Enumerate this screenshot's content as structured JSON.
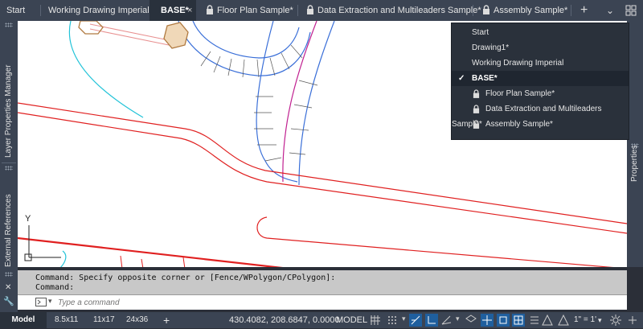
{
  "tabs": [
    {
      "label": "Start"
    },
    {
      "label": "Working Drawing Imperial"
    },
    {
      "label": "BASE*"
    },
    {
      "label": "Floor Plan Sample*"
    },
    {
      "label": "Data Extraction and Multileaders Sample*"
    },
    {
      "label": "Assembly Sample*"
    }
  ],
  "tab_close": "×",
  "new_tab": "+",
  "menu_caret": "⌄",
  "side_panels": {
    "left_top": "Layer Properties Manager",
    "left_bottom": "External References",
    "right": "Properties"
  },
  "dropdown": {
    "items": [
      {
        "label": "Start",
        "locked": false,
        "checked": false
      },
      {
        "label": "Drawing1*",
        "locked": false,
        "checked": false
      },
      {
        "label": "Working Drawing Imperial",
        "locked": false,
        "checked": false
      },
      {
        "label": "BASE*",
        "locked": false,
        "checked": true
      },
      {
        "label": "Floor Plan Sample*",
        "locked": true,
        "checked": false
      },
      {
        "label": "Data Extraction and Multileaders Sample*",
        "locked": true,
        "checked": false
      },
      {
        "label": "Assembly Sample*",
        "locked": true,
        "checked": false
      }
    ],
    "check": "✓"
  },
  "ucs": {
    "x_label": "",
    "y_label": "Y"
  },
  "command": {
    "history": [
      "Command: Specify opposite corner or [Fence/WPolygon/CPolygon]:",
      "Command:"
    ],
    "placeholder": "Type a command",
    "close_icon": "✕",
    "tools_icon": "🔧"
  },
  "status": {
    "layouts": [
      "Model",
      "8.5x11",
      "11x17",
      "24x36"
    ],
    "add_layout": "+",
    "coords": "430.4082, 208.6847, 0.0000",
    "space": "MODEL",
    "scale": "1\" = 1'",
    "scale_caret": "▾"
  },
  "colors": {
    "accent_blue": "#1f5f9e",
    "canvas_bg": "#ffffff",
    "chrome": "#3b4453"
  }
}
